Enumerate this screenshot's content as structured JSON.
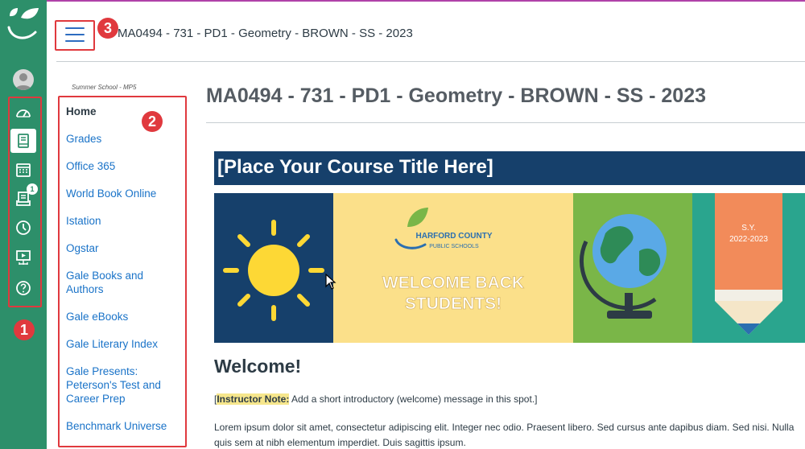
{
  "header": {
    "course_title": "MA0494 - 731 - PD1 - Geometry - BROWN - SS - 2023"
  },
  "global_nav": {
    "items": [
      {
        "icon": "dashboard-icon",
        "active": false
      },
      {
        "icon": "courses-icon",
        "active": true
      },
      {
        "icon": "calendar-icon",
        "active": false
      },
      {
        "icon": "inbox-icon",
        "active": false,
        "badge": "1"
      },
      {
        "icon": "history-icon",
        "active": false
      },
      {
        "icon": "studio-icon",
        "active": false
      },
      {
        "icon": "help-icon",
        "active": false
      }
    ]
  },
  "course_nav": {
    "term": "Summer School - MP5",
    "items": [
      {
        "label": "Home",
        "active": true
      },
      {
        "label": "Grades"
      },
      {
        "label": "Office 365"
      },
      {
        "label": "World Book Online"
      },
      {
        "label": "Istation"
      },
      {
        "label": "Ogstar"
      },
      {
        "label": "Gale Books and Authors"
      },
      {
        "label": "Gale eBooks"
      },
      {
        "label": "Gale Literary Index"
      },
      {
        "label": "Gale Presents: Peterson's Test and Career Prep"
      },
      {
        "label": "Benchmark Universe"
      }
    ]
  },
  "annotations": {
    "marker_1": "1",
    "marker_2": "2",
    "marker_3": "3"
  },
  "main": {
    "page_title": "MA0494 - 731 - PD1 - Geometry - BROWN - SS - 2023",
    "banner_title": "[Place Your Course Title Here]",
    "hero": {
      "logo_line1": "HARFORD COUNTY",
      "logo_line2": "PUBLIC SCHOOLS",
      "welcome_line1": "WELCOME BACK",
      "welcome_line2": "STUDENTS!",
      "sy_label": "S.Y.",
      "sy_years": "2022-2023"
    },
    "welcome_heading": "Welcome!",
    "note_open": "[",
    "note_label": "Instructor Note:",
    "note_text": " Add a short introductory (welcome) message in this spot.]",
    "lorem": "Lorem ipsum dolor sit amet, consectetur adipiscing elit. Integer nec odio. Praesent libero. Sed cursus ante dapibus diam. Sed nisi. Nulla quis sem at nibh elementum imperdiet. Duis sagittis ipsum."
  },
  "colors": {
    "nav_green": "#2d8f6a",
    "banner_navy": "#16406b",
    "link_blue": "#1a73c8",
    "annotation_red": "#e0393e"
  }
}
